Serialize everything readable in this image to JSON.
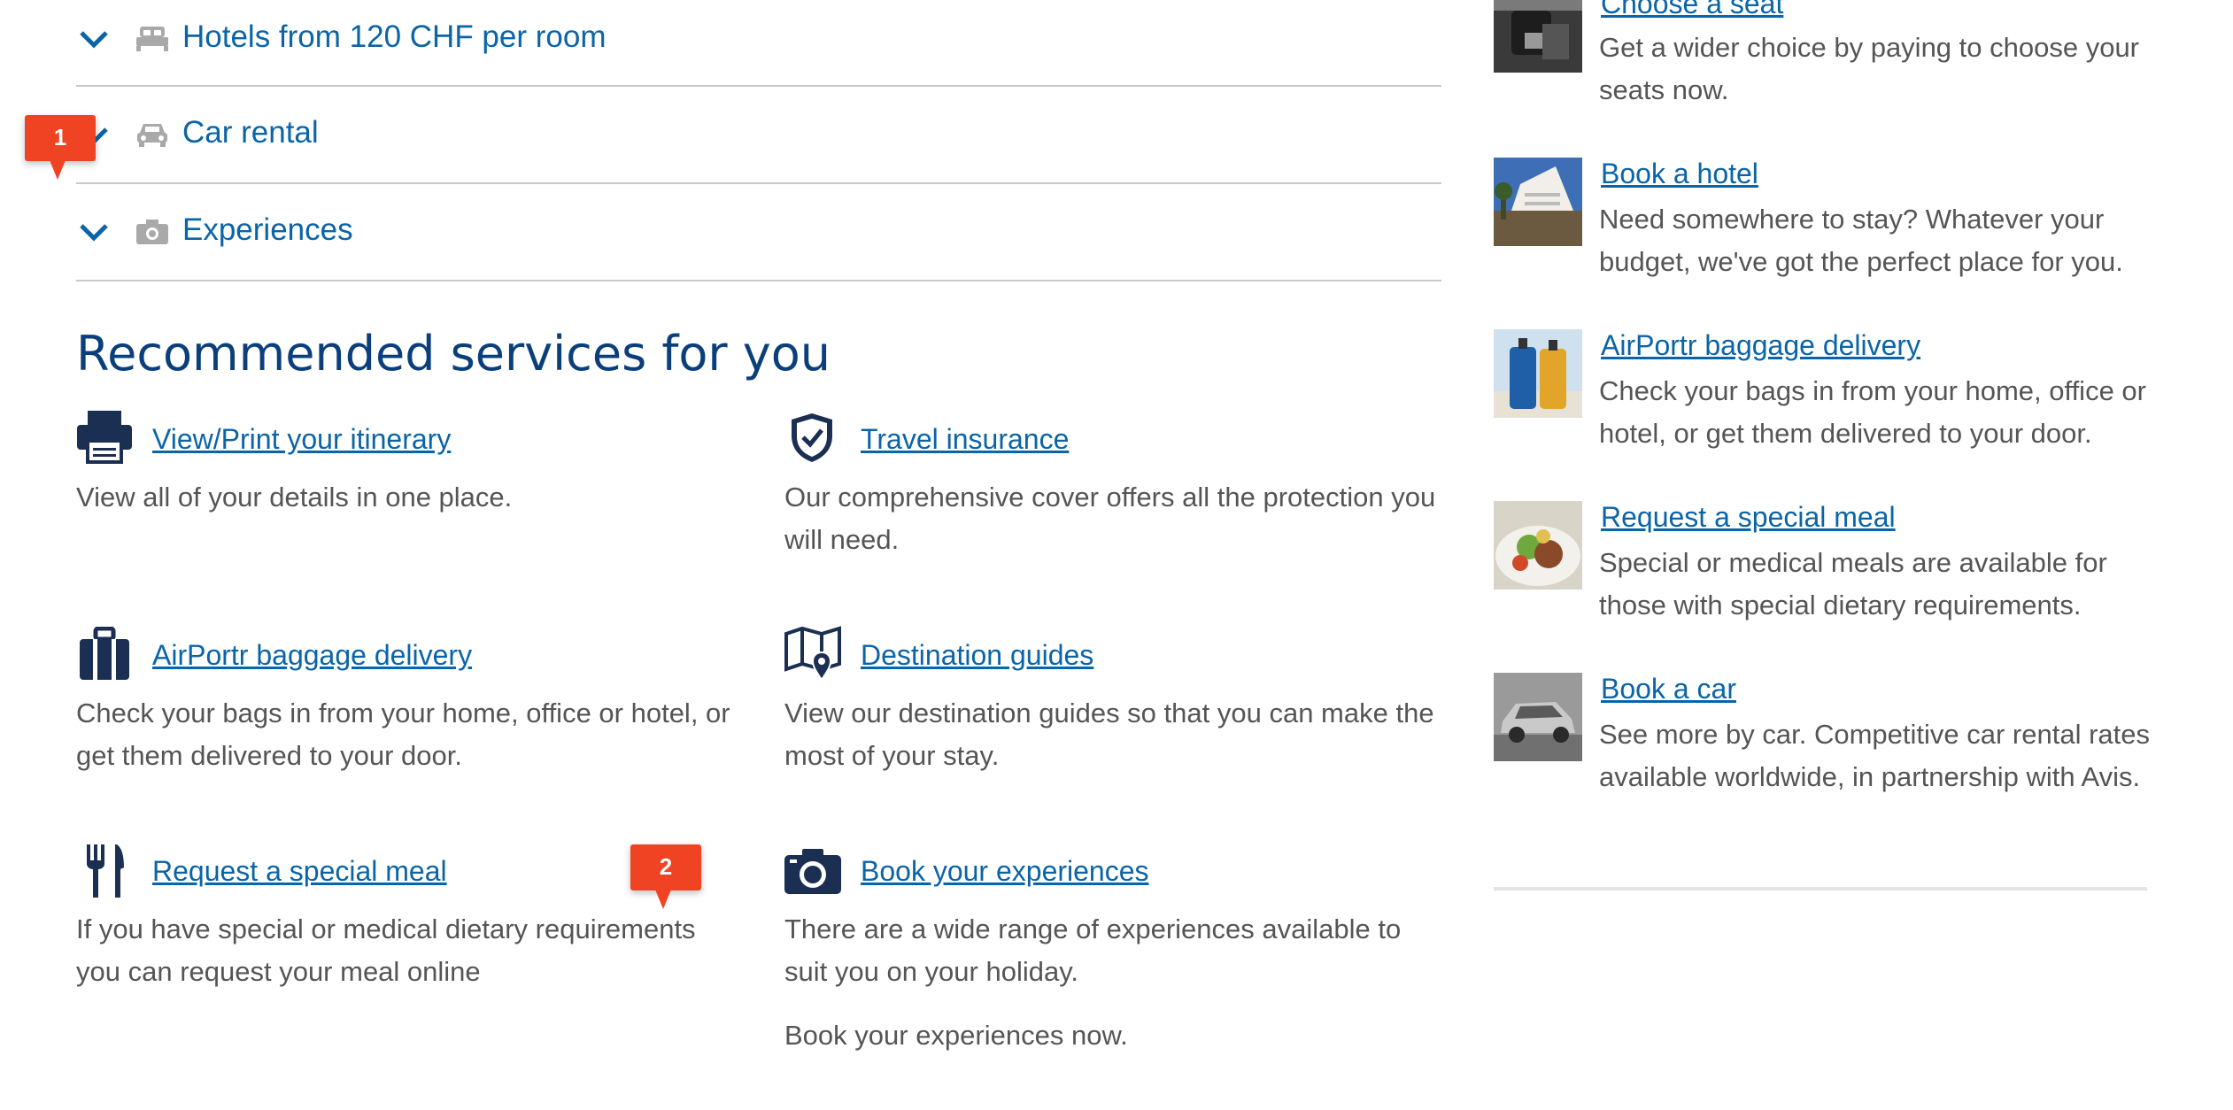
{
  "accordion": [
    {
      "label": "Hotels from 120 CHF per room",
      "icon": "bed-icon"
    },
    {
      "label": "Car rental",
      "icon": "car-icon"
    },
    {
      "label": "Experiences",
      "icon": "camera-icon"
    }
  ],
  "recommended": {
    "title": "Recommended services for you",
    "items": [
      {
        "link": "View/Print your itinerary",
        "desc": "View all of your details in one place.",
        "icon": "printer-icon"
      },
      {
        "link": "Travel insurance",
        "desc": "Our comprehensive cover offers all the protection you will need.",
        "icon": "shield-icon"
      },
      {
        "link": "AirPortr baggage delivery",
        "desc": "Check your bags in from your home, office or hotel, or get them delivered to your door.",
        "icon": "luggage-icon"
      },
      {
        "link": "Destination guides",
        "desc": "View our destination guides so that you can make the most of your stay.",
        "icon": "map-icon"
      },
      {
        "link": "Request a special meal",
        "desc": "If you have special or medical dietary requirements you can request your meal online",
        "icon": "cutlery-icon"
      },
      {
        "link": "Book your experiences",
        "desc": "There are a wide range of experiences available to suit you on your holiday.",
        "desc2": "Book your experiences now.",
        "icon": "camera-icon"
      }
    ]
  },
  "sidebar": {
    "items": [
      {
        "link": "Choose a seat",
        "desc": "Get a wider choice by paying to choose your seats now."
      },
      {
        "link": "Book a hotel",
        "desc": "Need somewhere to stay? Whatever your budget, we've got the perfect place for you."
      },
      {
        "link": "AirPortr baggage delivery",
        "desc": "Check your bags in from your home, office or hotel, or get them delivered to your door."
      },
      {
        "link": "Request a special meal",
        "desc": "Special or medical meals are available for those with special dietary requirements."
      },
      {
        "link": "Book a car",
        "desc": "See more by car. Competitive car rental rates available worldwide, in partnership with Avis."
      }
    ]
  },
  "badges": {
    "first": "1",
    "second": "2"
  },
  "colors": {
    "link": "#0a64a8",
    "heading": "#0b3f7c",
    "icon_dark": "#1b2f52",
    "badge": "#ef4323",
    "text": "#555555"
  }
}
